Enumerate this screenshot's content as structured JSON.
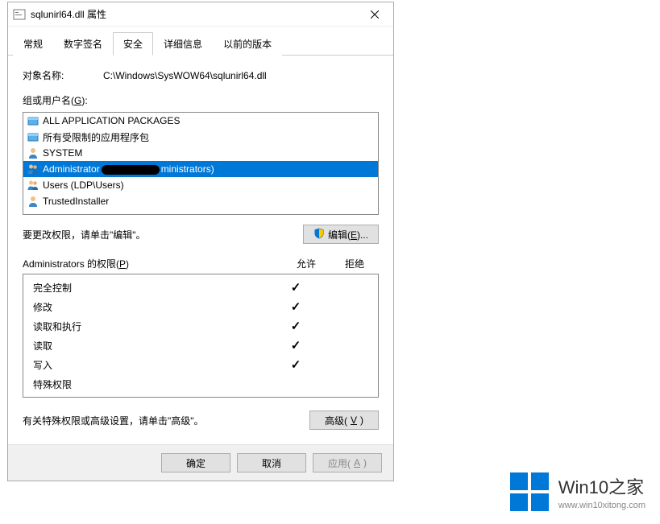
{
  "titlebar": {
    "title": "sqlunirl64.dll 属性"
  },
  "tabs": [
    {
      "label": "常规"
    },
    {
      "label": "数字签名"
    },
    {
      "label": "安全"
    },
    {
      "label": "详细信息"
    },
    {
      "label": "以前的版本"
    }
  ],
  "active_tab": 2,
  "object": {
    "label": "对象名称:",
    "value": "C:\\Windows\\SysWOW64\\sqlunirl64.dll"
  },
  "groups": {
    "label_prefix": "组或用户名(",
    "label_key": "G",
    "label_suffix": "):",
    "items": [
      {
        "icon": "package",
        "text": "ALL APPLICATION PACKAGES"
      },
      {
        "icon": "package",
        "text": "所有受限制的应用程序包"
      },
      {
        "icon": "user",
        "text": "SYSTEM"
      },
      {
        "icon": "group",
        "text_pre": "Administrator",
        "text_post": "ministrators)",
        "redacted": true
      },
      {
        "icon": "group",
        "text": "Users (LDP\\Users)"
      },
      {
        "icon": "user",
        "text": "TrustedInstaller"
      }
    ],
    "selected_index": 3
  },
  "edit": {
    "hint": "要更改权限，请单击\"编辑\"。",
    "button_prefix": "编辑(",
    "button_key": "E",
    "button_suffix": ")..."
  },
  "permissions": {
    "header_prefix": "Administrators 的权限(",
    "header_key": "P",
    "header_suffix": ")",
    "col_allow": "允许",
    "col_deny": "拒绝",
    "rows": [
      {
        "name": "完全控制",
        "allow": true,
        "deny": false
      },
      {
        "name": "修改",
        "allow": true,
        "deny": false
      },
      {
        "name": "读取和执行",
        "allow": true,
        "deny": false
      },
      {
        "name": "读取",
        "allow": true,
        "deny": false
      },
      {
        "name": "写入",
        "allow": true,
        "deny": false
      },
      {
        "name": "特殊权限",
        "allow": false,
        "deny": false
      }
    ]
  },
  "advanced": {
    "hint": "有关特殊权限或高级设置，请单击\"高级\"。",
    "button_prefix": "高级(",
    "button_key": "V",
    "button_suffix": ")"
  },
  "buttons": {
    "ok": "确定",
    "cancel": "取消",
    "apply_prefix": "应用(",
    "apply_key": "A",
    "apply_suffix": ")"
  },
  "logo": {
    "title": "Win10之家",
    "url": "www.win10xitong.com"
  }
}
